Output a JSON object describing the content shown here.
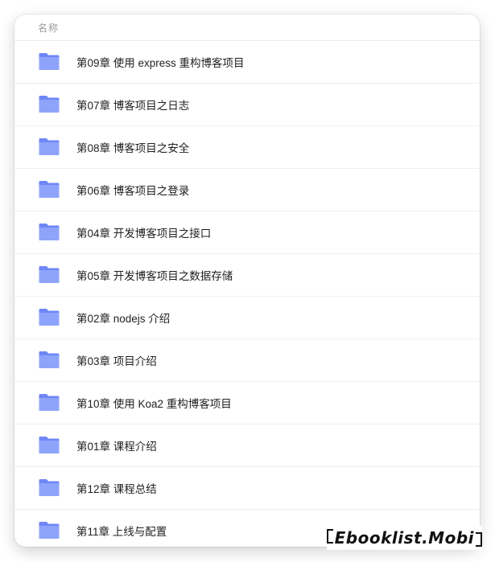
{
  "header": {
    "column_label": "名称"
  },
  "folder_icon": "folder-icon",
  "colors": {
    "folder_back": "#6f86f6",
    "folder_front": "#8ea4fb",
    "text": "#1f1f1f",
    "header_text": "#9a9a9a"
  },
  "items": [
    {
      "label": "第09章 使用 express 重构博客项目"
    },
    {
      "label": "第07章 博客项目之日志"
    },
    {
      "label": "第08章 博客项目之安全"
    },
    {
      "label": "第06章 博客项目之登录"
    },
    {
      "label": "第04章 开发博客项目之接口"
    },
    {
      "label": "第05章 开发博客项目之数据存储"
    },
    {
      "label": "第02章 nodejs 介绍"
    },
    {
      "label": "第03章 项目介绍"
    },
    {
      "label": "第10章 使用 Koa2 重构博客项目"
    },
    {
      "label": "第01章 课程介绍"
    },
    {
      "label": "第12章 课程总结"
    },
    {
      "label": "第11章 上线与配置"
    }
  ],
  "watermark": {
    "text": "Ebooklist.Mobi"
  }
}
